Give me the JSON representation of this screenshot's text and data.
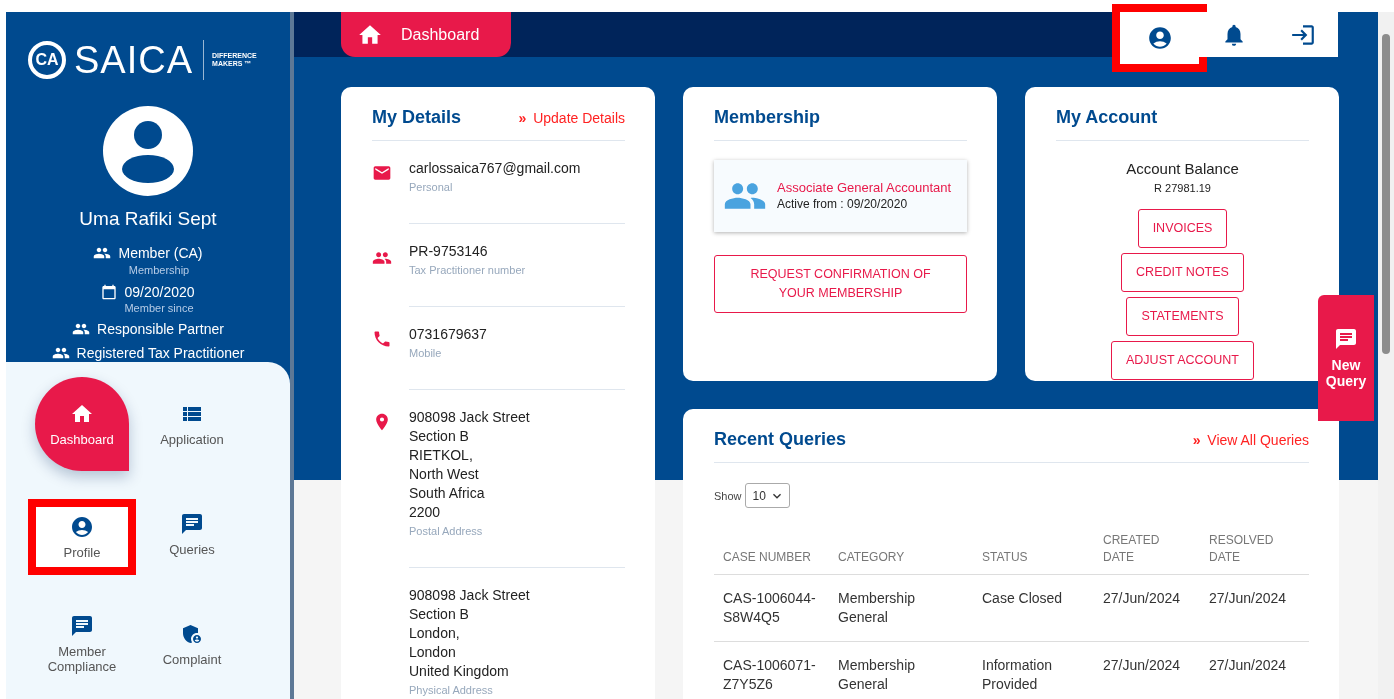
{
  "sidebar": {
    "logo": {
      "mark": "CA",
      "name": "SAICA",
      "tagline": "DIFFERENCE MAKERS ™"
    },
    "profile": {
      "name": "Uma Rafiki Sept",
      "facts": [
        {
          "kind": "people",
          "value": "Member (CA)",
          "caption": "Membership"
        },
        {
          "kind": "calendar",
          "value": "09/20/2020",
          "caption": "Member since"
        },
        {
          "kind": "people",
          "value": "Responsible Partner"
        },
        {
          "kind": "people",
          "value": "Registered Tax Practitioner"
        }
      ]
    },
    "nav": [
      {
        "kind": "home",
        "label": "Dashboard",
        "selected": true,
        "highlighted": false
      },
      {
        "kind": "list",
        "label": "Application",
        "selected": false,
        "highlighted": false
      },
      {
        "kind": "profile",
        "label": "Profile",
        "selected": false,
        "highlighted": true
      },
      {
        "kind": "chat",
        "label": "Queries",
        "selected": false,
        "highlighted": false
      },
      {
        "kind": "chat",
        "label": "Member Compliance",
        "selected": false,
        "highlighted": false
      },
      {
        "kind": "shield",
        "label": "Complaint",
        "selected": false,
        "highlighted": false
      }
    ]
  },
  "topbar": {
    "tab": {
      "label": "Dashboard"
    },
    "actions": [
      {
        "kind": "profile",
        "highlighted": true
      },
      {
        "kind": "notifications",
        "highlighted": false
      },
      {
        "kind": "logout",
        "highlighted": false
      }
    ]
  },
  "my_details": {
    "title": "My Details",
    "link": "**»** Update Details",
    "items": [
      {
        "kind": "email",
        "lines": [
          "carlossaica767@gmail.com"
        ],
        "caption": "Personal"
      },
      {
        "kind": "people",
        "lines": [
          "PR-9753146"
        ],
        "caption": "Tax Practitioner number"
      },
      {
        "kind": "phone",
        "lines": [
          "0731679637"
        ],
        "caption": "Mobile"
      },
      {
        "kind": "place",
        "lines": [
          "908098 Jack Street",
          "Section B",
          "RIETKOL,",
          "North West",
          "South Africa",
          "2200"
        ],
        "caption": "Postal Address"
      },
      {
        "kind": "plain",
        "lines": [
          "908098 Jack Street",
          "Section B",
          "London,",
          "London",
          "United Kingdom"
        ],
        "caption": "Physical Address"
      }
    ]
  },
  "membership": {
    "title": "Membership",
    "current": {
      "name": "Associate General Accountant",
      "active": "Active from : 09/20/2020"
    },
    "button": "REQUEST CONFIRMATION OF YOUR MEMBERSHIP"
  },
  "my_account": {
    "title": "My Account",
    "balance_label": "Account Balance",
    "balance": "R 27981.19",
    "buttons": [
      "INVOICES",
      "CREDIT NOTES",
      "STATEMENTS",
      "ADJUST ACCOUNT"
    ]
  },
  "recent_queries": {
    "title": "Recent Queries",
    "link": "**»** View All Queries",
    "show_label": "Show",
    "page_size": "10",
    "columns": [
      "CASE NUMBER",
      "CATEGORY",
      "STATUS",
      "CREATED DATE",
      "RESOLVED DATE"
    ],
    "rows": [
      [
        "CAS-1006044-S8W4Q5",
        "Membership General",
        "Case Closed",
        "27/Jun/2024",
        "27/Jun/2024"
      ],
      [
        "CAS-1006071-Z7Y5Z6",
        "Membership General",
        "Information Provided",
        "27/Jun/2024",
        "27/Jun/2024"
      ]
    ]
  },
  "new_query": {
    "label": "New Query"
  }
}
